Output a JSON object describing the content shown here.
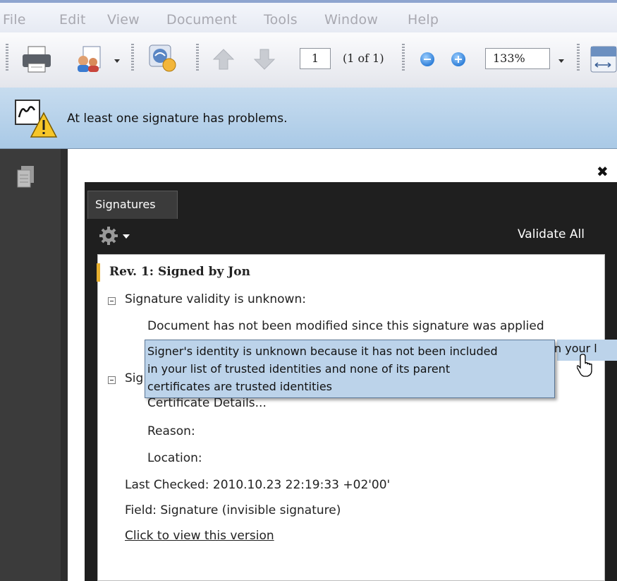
{
  "menubar": {
    "items": [
      "File",
      "Edit",
      "View",
      "Document",
      "Tools",
      "Window",
      "Help"
    ]
  },
  "toolbar": {
    "icons": [
      "print-icon",
      "collaborate-icon",
      "sign-icon",
      "prev-page-icon",
      "next-page-icon",
      "zoom-out-icon",
      "zoom-in-icon",
      "fit-width-icon"
    ],
    "page_number": "1",
    "page_count": "(1 of 1)",
    "zoom": "133%"
  },
  "message_bar": {
    "icon": "signature-warning-icon",
    "text": "At least one signature has problems."
  },
  "signatures_panel": {
    "tab_label": "Signatures",
    "options_icon": "gear-icon",
    "validate_all": "Validate All",
    "revision_title": "Rev. 1: Signed by Jon",
    "validity_header": "Signature validity is unknown:",
    "not_modified": "Document has not been modified since this signature was applied",
    "identity_row_fragment": "n your l",
    "details_header_fragment": "Sig",
    "certificate_details": "Certificate Details...",
    "reason": "Reason:",
    "location": "Location:",
    "last_checked": "Last Checked: 2010.10.23 22:19:33 +02'00'",
    "field": "Field: Signature (invisible signature)",
    "view_version_link": "Click to view this version"
  },
  "tooltip": {
    "lines": [
      "Signer's identity is unknown because it has not been included",
      "in your list of trusted identities and none of its parent",
      "certificates are trusted identities"
    ]
  },
  "colors": {
    "message_bar": "#b4cfe9",
    "tooltip_bg": "#bcd3ea",
    "panel_bg": "#1f1f1f"
  }
}
